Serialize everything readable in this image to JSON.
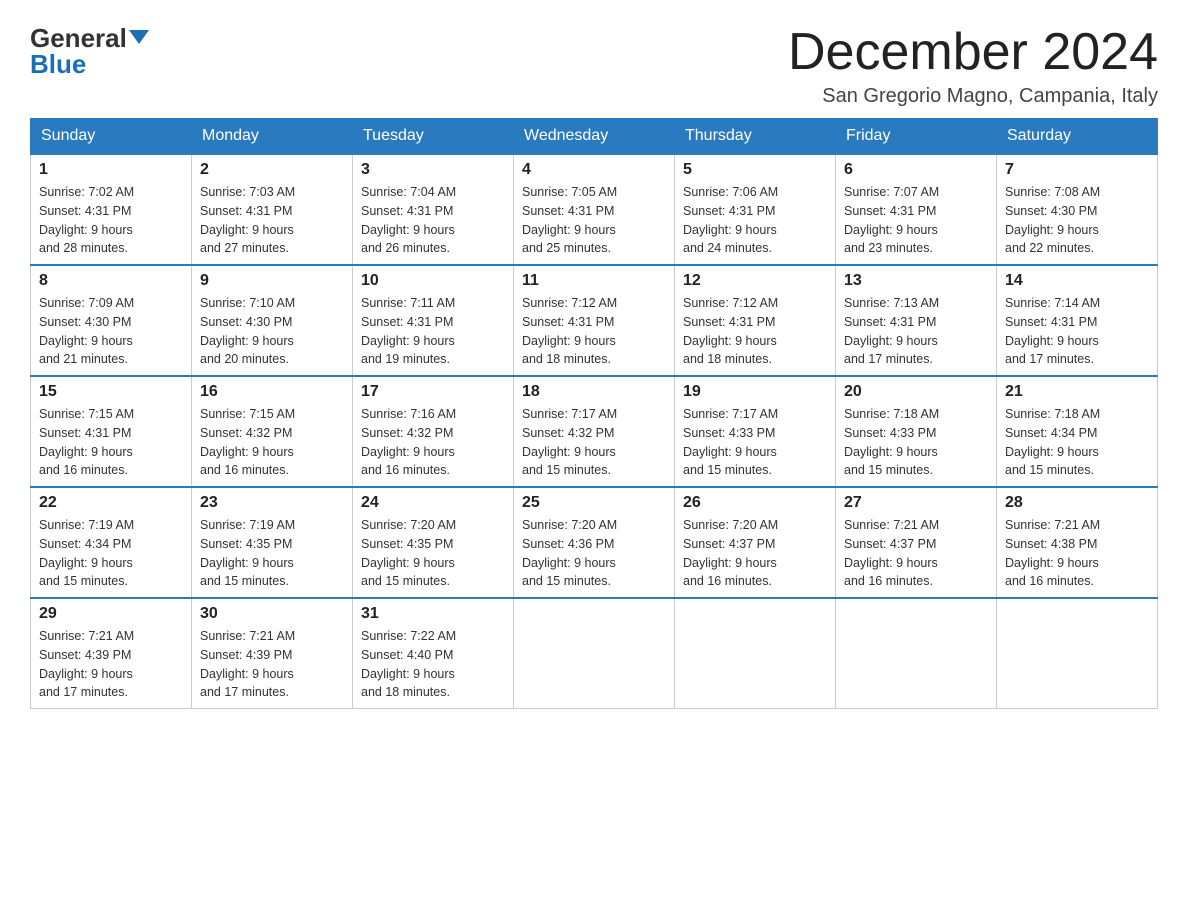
{
  "header": {
    "logo_line1": "General",
    "logo_line2": "Blue",
    "month_title": "December 2024",
    "location": "San Gregorio Magno, Campania, Italy"
  },
  "weekdays": [
    "Sunday",
    "Monday",
    "Tuesday",
    "Wednesday",
    "Thursday",
    "Friday",
    "Saturday"
  ],
  "weeks": [
    [
      {
        "day": "1",
        "sunrise": "7:02 AM",
        "sunset": "4:31 PM",
        "daylight": "9 hours and 28 minutes."
      },
      {
        "day": "2",
        "sunrise": "7:03 AM",
        "sunset": "4:31 PM",
        "daylight": "9 hours and 27 minutes."
      },
      {
        "day": "3",
        "sunrise": "7:04 AM",
        "sunset": "4:31 PM",
        "daylight": "9 hours and 26 minutes."
      },
      {
        "day": "4",
        "sunrise": "7:05 AM",
        "sunset": "4:31 PM",
        "daylight": "9 hours and 25 minutes."
      },
      {
        "day": "5",
        "sunrise": "7:06 AM",
        "sunset": "4:31 PM",
        "daylight": "9 hours and 24 minutes."
      },
      {
        "day": "6",
        "sunrise": "7:07 AM",
        "sunset": "4:31 PM",
        "daylight": "9 hours and 23 minutes."
      },
      {
        "day": "7",
        "sunrise": "7:08 AM",
        "sunset": "4:30 PM",
        "daylight": "9 hours and 22 minutes."
      }
    ],
    [
      {
        "day": "8",
        "sunrise": "7:09 AM",
        "sunset": "4:30 PM",
        "daylight": "9 hours and 21 minutes."
      },
      {
        "day": "9",
        "sunrise": "7:10 AM",
        "sunset": "4:30 PM",
        "daylight": "9 hours and 20 minutes."
      },
      {
        "day": "10",
        "sunrise": "7:11 AM",
        "sunset": "4:31 PM",
        "daylight": "9 hours and 19 minutes."
      },
      {
        "day": "11",
        "sunrise": "7:12 AM",
        "sunset": "4:31 PM",
        "daylight": "9 hours and 18 minutes."
      },
      {
        "day": "12",
        "sunrise": "7:12 AM",
        "sunset": "4:31 PM",
        "daylight": "9 hours and 18 minutes."
      },
      {
        "day": "13",
        "sunrise": "7:13 AM",
        "sunset": "4:31 PM",
        "daylight": "9 hours and 17 minutes."
      },
      {
        "day": "14",
        "sunrise": "7:14 AM",
        "sunset": "4:31 PM",
        "daylight": "9 hours and 17 minutes."
      }
    ],
    [
      {
        "day": "15",
        "sunrise": "7:15 AM",
        "sunset": "4:31 PM",
        "daylight": "9 hours and 16 minutes."
      },
      {
        "day": "16",
        "sunrise": "7:15 AM",
        "sunset": "4:32 PM",
        "daylight": "9 hours and 16 minutes."
      },
      {
        "day": "17",
        "sunrise": "7:16 AM",
        "sunset": "4:32 PM",
        "daylight": "9 hours and 16 minutes."
      },
      {
        "day": "18",
        "sunrise": "7:17 AM",
        "sunset": "4:32 PM",
        "daylight": "9 hours and 15 minutes."
      },
      {
        "day": "19",
        "sunrise": "7:17 AM",
        "sunset": "4:33 PM",
        "daylight": "9 hours and 15 minutes."
      },
      {
        "day": "20",
        "sunrise": "7:18 AM",
        "sunset": "4:33 PM",
        "daylight": "9 hours and 15 minutes."
      },
      {
        "day": "21",
        "sunrise": "7:18 AM",
        "sunset": "4:34 PM",
        "daylight": "9 hours and 15 minutes."
      }
    ],
    [
      {
        "day": "22",
        "sunrise": "7:19 AM",
        "sunset": "4:34 PM",
        "daylight": "9 hours and 15 minutes."
      },
      {
        "day": "23",
        "sunrise": "7:19 AM",
        "sunset": "4:35 PM",
        "daylight": "9 hours and 15 minutes."
      },
      {
        "day": "24",
        "sunrise": "7:20 AM",
        "sunset": "4:35 PM",
        "daylight": "9 hours and 15 minutes."
      },
      {
        "day": "25",
        "sunrise": "7:20 AM",
        "sunset": "4:36 PM",
        "daylight": "9 hours and 15 minutes."
      },
      {
        "day": "26",
        "sunrise": "7:20 AM",
        "sunset": "4:37 PM",
        "daylight": "9 hours and 16 minutes."
      },
      {
        "day": "27",
        "sunrise": "7:21 AM",
        "sunset": "4:37 PM",
        "daylight": "9 hours and 16 minutes."
      },
      {
        "day": "28",
        "sunrise": "7:21 AM",
        "sunset": "4:38 PM",
        "daylight": "9 hours and 16 minutes."
      }
    ],
    [
      {
        "day": "29",
        "sunrise": "7:21 AM",
        "sunset": "4:39 PM",
        "daylight": "9 hours and 17 minutes."
      },
      {
        "day": "30",
        "sunrise": "7:21 AM",
        "sunset": "4:39 PM",
        "daylight": "9 hours and 17 minutes."
      },
      {
        "day": "31",
        "sunrise": "7:22 AM",
        "sunset": "4:40 PM",
        "daylight": "9 hours and 18 minutes."
      },
      null,
      null,
      null,
      null
    ]
  ],
  "labels": {
    "sunrise": "Sunrise:",
    "sunset": "Sunset:",
    "daylight": "Daylight:"
  }
}
